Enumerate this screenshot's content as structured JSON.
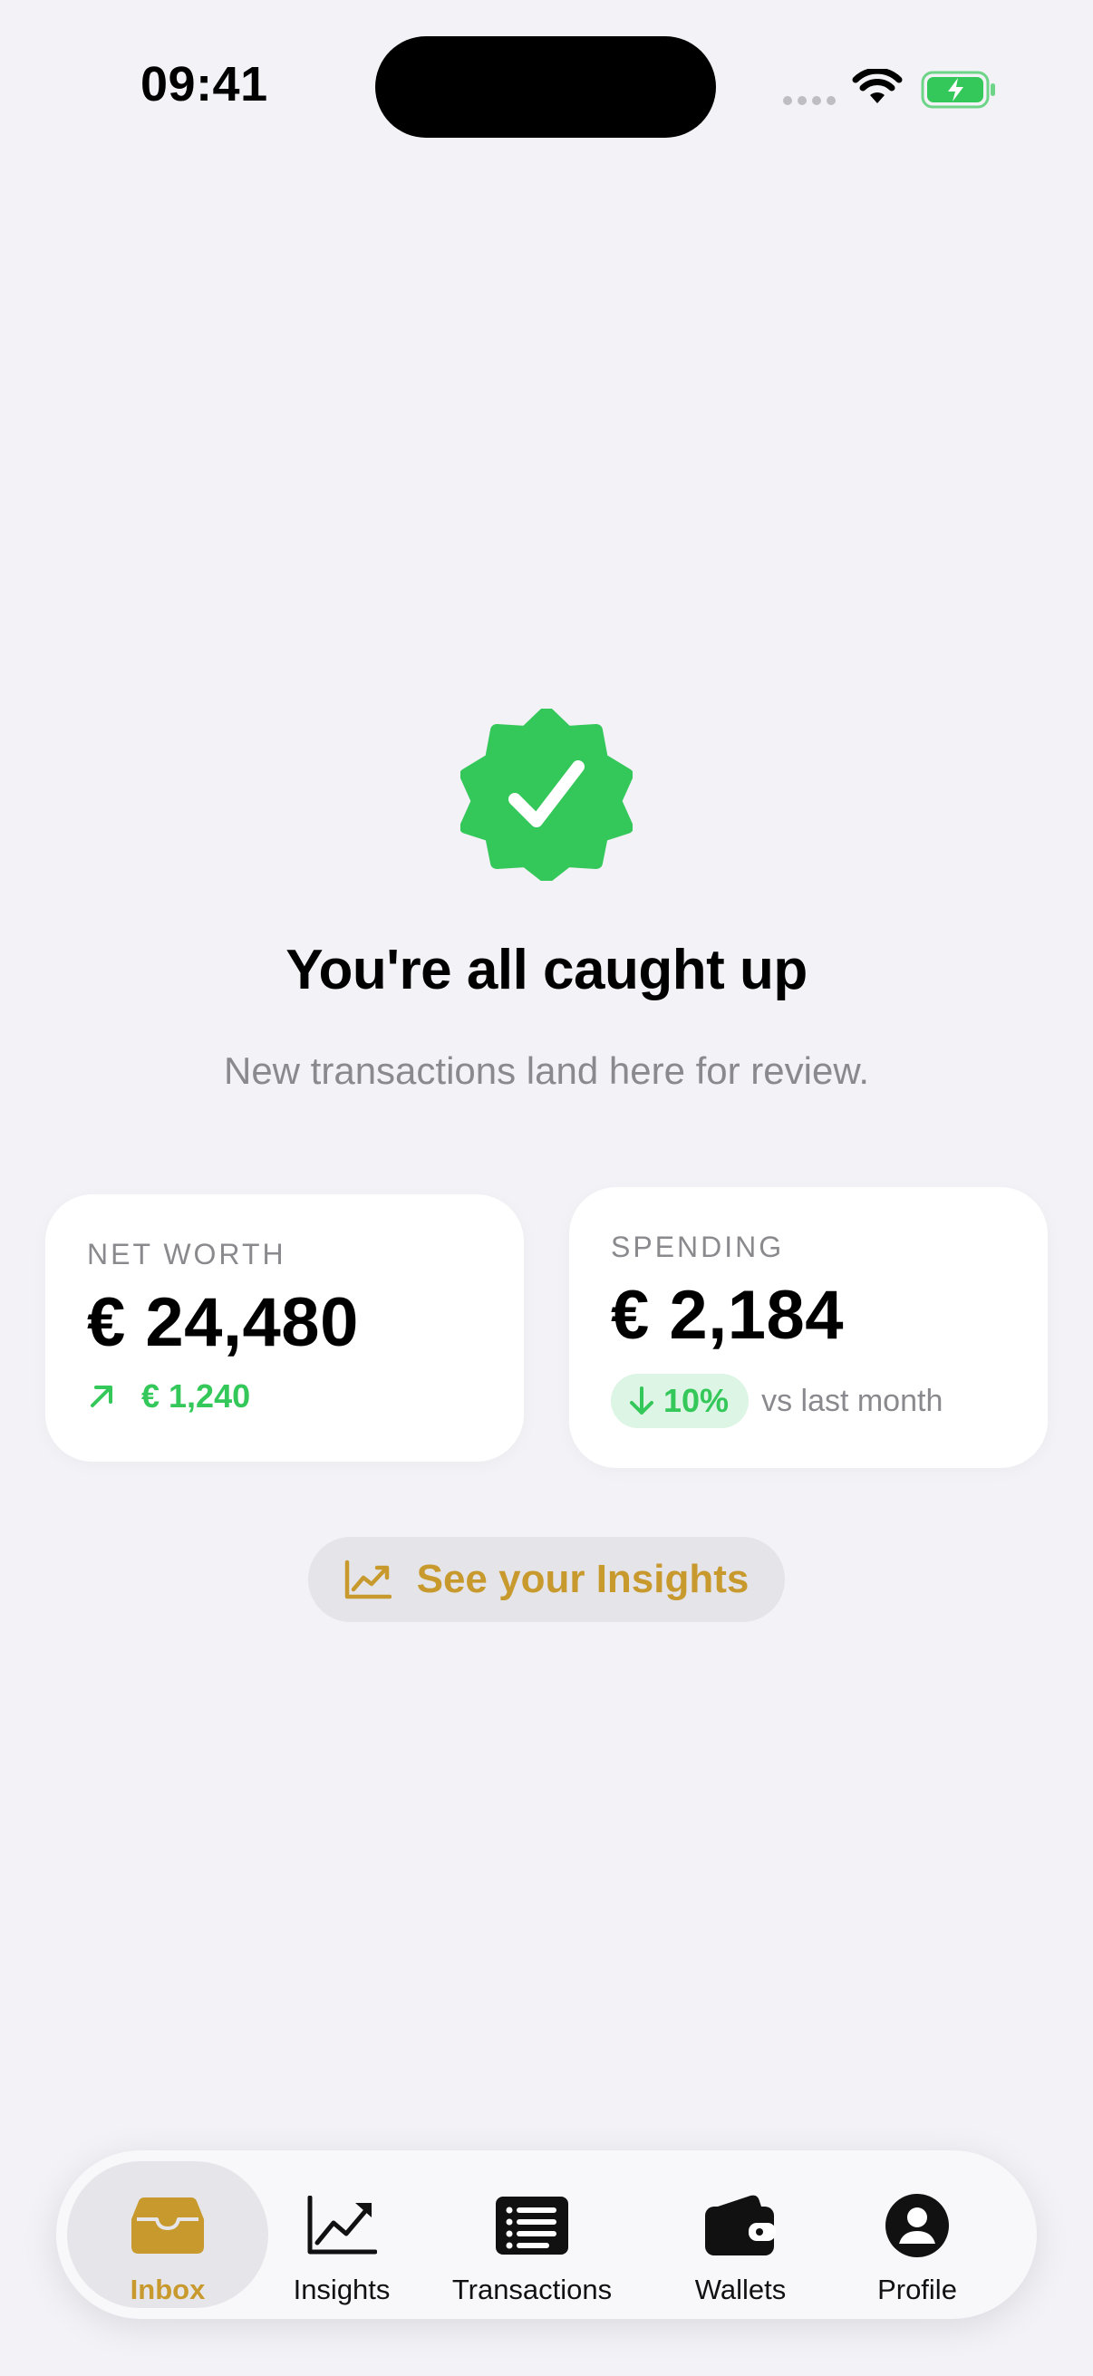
{
  "status_bar": {
    "time": "09:41"
  },
  "hero": {
    "title": "You're all caught up",
    "subtitle": "New transactions land here for review."
  },
  "cards": {
    "net_worth": {
      "label": "NET WORTH",
      "value": "€ 24,480",
      "change": "€ 1,240"
    },
    "spending": {
      "label": "SPENDING",
      "value": "€ 2,184",
      "change_pct": "10%",
      "comparison": "vs last month"
    }
  },
  "insights_button": {
    "label": "See your Insights"
  },
  "tab_bar": {
    "items": [
      {
        "label": "Inbox",
        "icon": "inbox-tray-icon",
        "active": true
      },
      {
        "label": "Insights",
        "icon": "chart-line-up-icon",
        "active": false
      },
      {
        "label": "Transactions",
        "icon": "list-icon",
        "active": false
      },
      {
        "label": "Wallets",
        "icon": "wallet-icon",
        "active": false
      },
      {
        "label": "Profile",
        "icon": "person-circle-icon",
        "active": false
      }
    ]
  },
  "colors": {
    "accent": "#C89A2E",
    "positive": "#34C759",
    "background": "#F2F2F7",
    "secondary_text": "#8A8A8E"
  }
}
